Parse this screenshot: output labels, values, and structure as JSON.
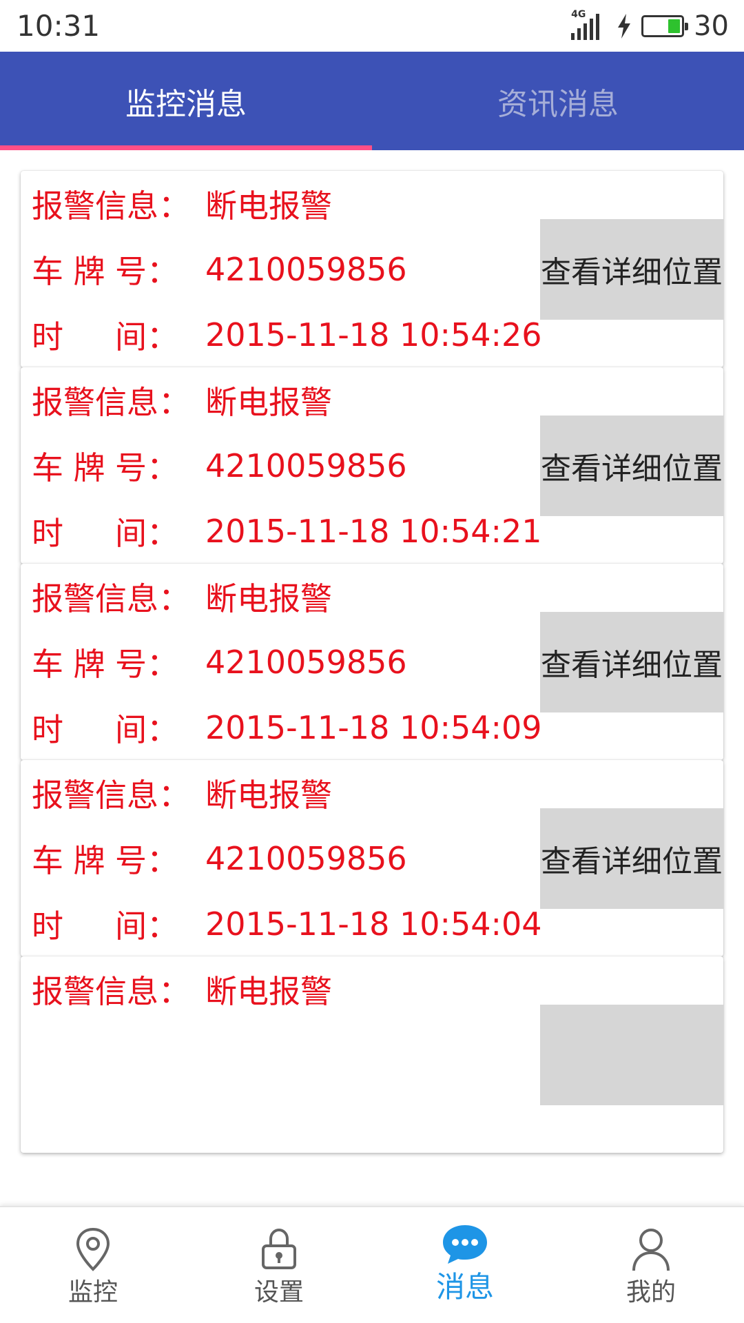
{
  "status_bar": {
    "time": "10:31",
    "network": "4G",
    "battery_percent": "30",
    "battery_level": 0.3
  },
  "tabs": [
    {
      "label": "监控消息",
      "active": true
    },
    {
      "label": "资讯消息",
      "active": false
    }
  ],
  "colors": {
    "tab_bar": "#3d52b6",
    "tab_indicator": "#ff4f87",
    "alert_text": "#e8111d",
    "detail_button_bg": "#d6d6d6",
    "nav_active": "#1e95e6"
  },
  "labels": {
    "alarm_info": "报警信息：",
    "plate_chars": [
      "车",
      "牌",
      "号："
    ],
    "time_chars": [
      "时",
      "间："
    ]
  },
  "messages": [
    {
      "alarm": "断电报警",
      "plate": "4210059856",
      "time": "2015-11-18 10:54:26",
      "button": "查看详细位置"
    },
    {
      "alarm": "断电报警",
      "plate": "4210059856",
      "time": "2015-11-18 10:54:21",
      "button": "查看详细位置"
    },
    {
      "alarm": "断电报警",
      "plate": "4210059856",
      "time": "2015-11-18 10:54:09",
      "button": "查看详细位置"
    },
    {
      "alarm": "断电报警",
      "plate": "4210059856",
      "time": "2015-11-18 10:54:04",
      "button": "查看详细位置"
    },
    {
      "alarm": "断电报警",
      "plate": "",
      "time": "",
      "button": ""
    }
  ],
  "bottom_nav": [
    {
      "label": "监控",
      "icon": "location-pin-icon",
      "active": false
    },
    {
      "label": "设置",
      "icon": "lock-icon",
      "active": false
    },
    {
      "label": "消息",
      "icon": "chat-bubble-icon",
      "active": true
    },
    {
      "label": "我的",
      "icon": "person-icon",
      "active": false
    }
  ]
}
